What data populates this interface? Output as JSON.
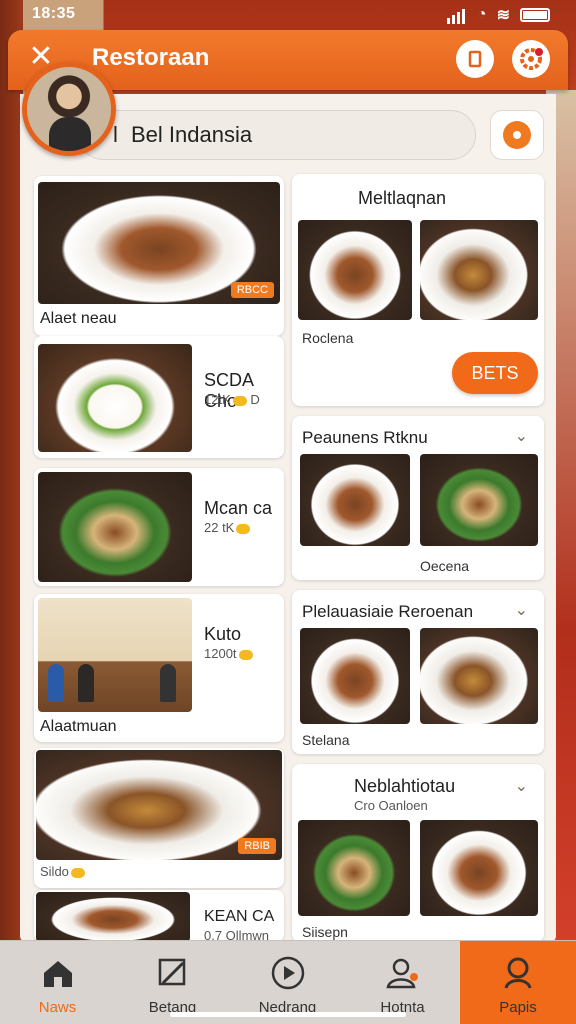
{
  "status": {
    "time": "18:35"
  },
  "header": {
    "title": "Restoraan"
  },
  "search": {
    "prefix": "l",
    "value": "Bel Indansia"
  },
  "left_cards": [
    {
      "label": "Alaet neau",
      "badge": "RBCC"
    },
    {
      "title": "SCDA Cho",
      "price": "12tK",
      "price_tail": "D"
    },
    {
      "title": "Mcan ca",
      "price": "22 tK"
    },
    {
      "title": "Kuto",
      "price": "1200t"
    },
    {
      "label": "Alaatmuan"
    },
    {
      "label": "Sildo",
      "badge": "RBIB"
    },
    {
      "title": "KEAN CA",
      "price": "0.7 Ollmwn"
    }
  ],
  "right_sections": [
    {
      "title": "Meltlaqnan",
      "caption": "Roclena",
      "cta": "BETS"
    },
    {
      "title": "Peaunens Rtknu",
      "caption": "Oecena"
    },
    {
      "title": "Plelauasiaie Reroenan",
      "caption": "Stelana"
    },
    {
      "title": "Neblahtiotau",
      "subtitle": "Cro Oanloen",
      "caption": "Siisepn"
    }
  ],
  "tabs": [
    {
      "label": "Naws",
      "icon": "home-icon"
    },
    {
      "label": "Betang",
      "icon": "edit-icon"
    },
    {
      "label": "Nedrang",
      "icon": "play-icon"
    },
    {
      "label": "Hotnta",
      "icon": "user-settings-icon"
    },
    {
      "label": "Papis",
      "icon": "profile-icon"
    }
  ],
  "colors": {
    "accent": "#f06a1a",
    "header": "#e4621c"
  }
}
